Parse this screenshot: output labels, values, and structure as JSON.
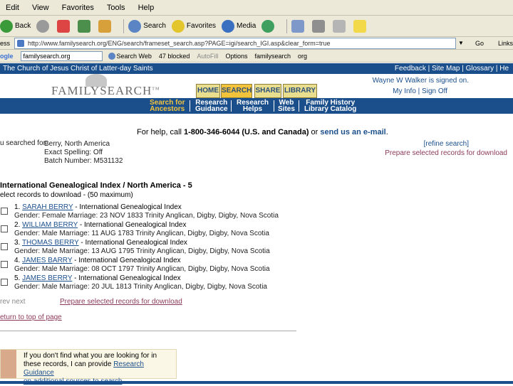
{
  "menu": [
    "Edit",
    "View",
    "Favorites",
    "Tools",
    "Help"
  ],
  "toolbar": {
    "back": "Back",
    "search": "Search",
    "favorites": "Favorites",
    "media": "Media"
  },
  "address": {
    "label": "ess",
    "url": "http://www.familysearch.org/ENG/search/frameset_search.asp?PAGE=igi/search_IGI.asp&clear_form=true",
    "go": "Go",
    "links": "Links"
  },
  "google": {
    "logo": "ogle",
    "box": "familysearch.org",
    "search_web": "Search Web",
    "blocked": "47 blocked",
    "autofill": "AutoFill",
    "options": "Options",
    "term1": "familysearch",
    "term2": "org"
  },
  "church": {
    "title": "The Church of Jesus Christ of Latter-day Saints",
    "links": "Feedback | Site Map | Glossary | He"
  },
  "brand": {
    "logo": "FAMILYSEARCH",
    "tm": "TM",
    "user": "Wayne W Walker is signed on.",
    "account": "My Info | Sign Off"
  },
  "tabs": [
    "HOME",
    "SEARCH",
    "SHARE",
    "LIBRARY"
  ],
  "subnav": [
    {
      "line1": "Search for",
      "line2": "Ancestors"
    },
    {
      "line1": "Research",
      "line2": "Guidance"
    },
    {
      "line1": "Research",
      "line2": "Helps"
    },
    {
      "line1": "Web",
      "line2": "Sites"
    },
    {
      "line1": "Family History",
      "line2": "Library Catalog"
    }
  ],
  "help": {
    "pre": "For help, call ",
    "phone": "1-800-346-6044 (U.S. and Canada)",
    "mid": " or ",
    "email": "send us an e-mail",
    "post": "."
  },
  "criteria": {
    "label": "u searched for:",
    "items": [
      "Berry, North America",
      "Exact Spelling: Off",
      "Batch Number: M531132"
    ]
  },
  "refine": "[refine search]",
  "prepare": "Prepare selected records for download",
  "results": {
    "title": "International Genealogical Index / North America - 5",
    "select_note": "elect records to download - (50 maximum)"
  },
  "records": [
    {
      "num": "1.",
      "name": "SARAH BERRY",
      "source": " - International Genealogical Index",
      "details": "Gender: Female Marriage: 23 NOV 1833 Trinity Anglican, Digby, Digby, Nova Scotia"
    },
    {
      "num": "2.",
      "name": "WILLIAM BERRY",
      "source": " - International Genealogical Index",
      "details": "Gender: Male Marriage: 11 AUG 1783 Trinity Anglican, Digby, Digby, Nova Scotia"
    },
    {
      "num": "3.",
      "name": "THOMAS BERRY",
      "source": " - International Genealogical Index",
      "details": "Gender: Male Marriage: 13 AUG 1795 Trinity Anglican, Digby, Digby, Nova Scotia"
    },
    {
      "num": "4.",
      "name": "JAMES BARRY",
      "source": " - International Genealogical Index",
      "details": "Gender: Male Marriage: 08 OCT 1797 Trinity Anglican, Digby, Digby, Nova Scotia"
    },
    {
      "num": "5.",
      "name": "JAMES BERRY",
      "source": " - International Genealogical Index",
      "details": "Gender: Male Marriage: 20 JUL 1813 Trinity Anglican, Digby, Digby, Nova Scotia"
    }
  ],
  "prevnext": "rev   next",
  "return_top": "eturn to top of page",
  "promo": {
    "pre": "If you don't find what you are looking for in these records, I can provide ",
    "link1": "Research Guidance",
    "link2": "on additional sources to search"
  },
  "colors": {
    "brand_blue": "#1b4f8c",
    "link_purple": "#8c3a5a",
    "tab_gold": "#e8de8e",
    "tab_active": "#f3c33b"
  }
}
